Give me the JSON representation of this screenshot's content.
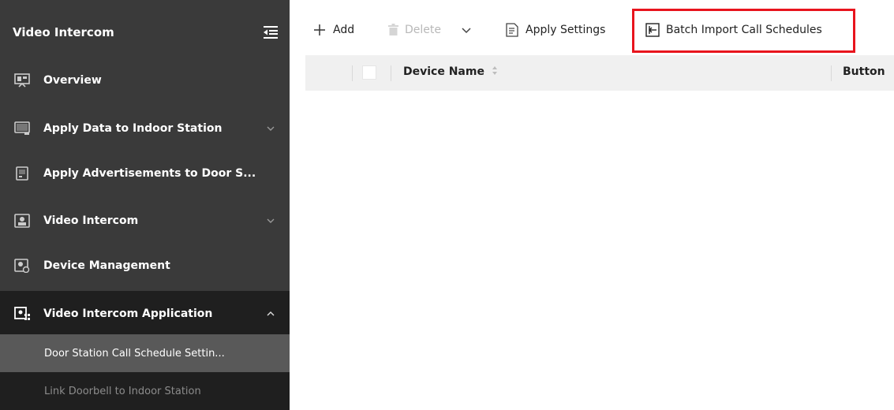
{
  "sidebar": {
    "title": "Video Intercom",
    "items": [
      {
        "label": "Overview"
      },
      {
        "label": "Apply Data to Indoor Station"
      },
      {
        "label": "Apply Advertisements to Door S..."
      },
      {
        "label": "Video Intercom"
      },
      {
        "label": "Device Management"
      },
      {
        "label": "Video Intercom Application"
      }
    ],
    "subitems": [
      {
        "label": "Door Station Call Schedule Settin..."
      },
      {
        "label": "Link Doorbell to Indoor Station"
      }
    ]
  },
  "toolbar": {
    "add_label": "Add",
    "delete_label": "Delete",
    "apply_label": "Apply Settings",
    "batch_import_label": "Batch Import Call Schedules"
  },
  "table": {
    "columns": [
      "Device Name",
      "Button"
    ]
  },
  "colors": {
    "sidebar_bg": "#3a3a3a",
    "active_sub_bg": "#595959",
    "highlight": "#e8141d"
  }
}
